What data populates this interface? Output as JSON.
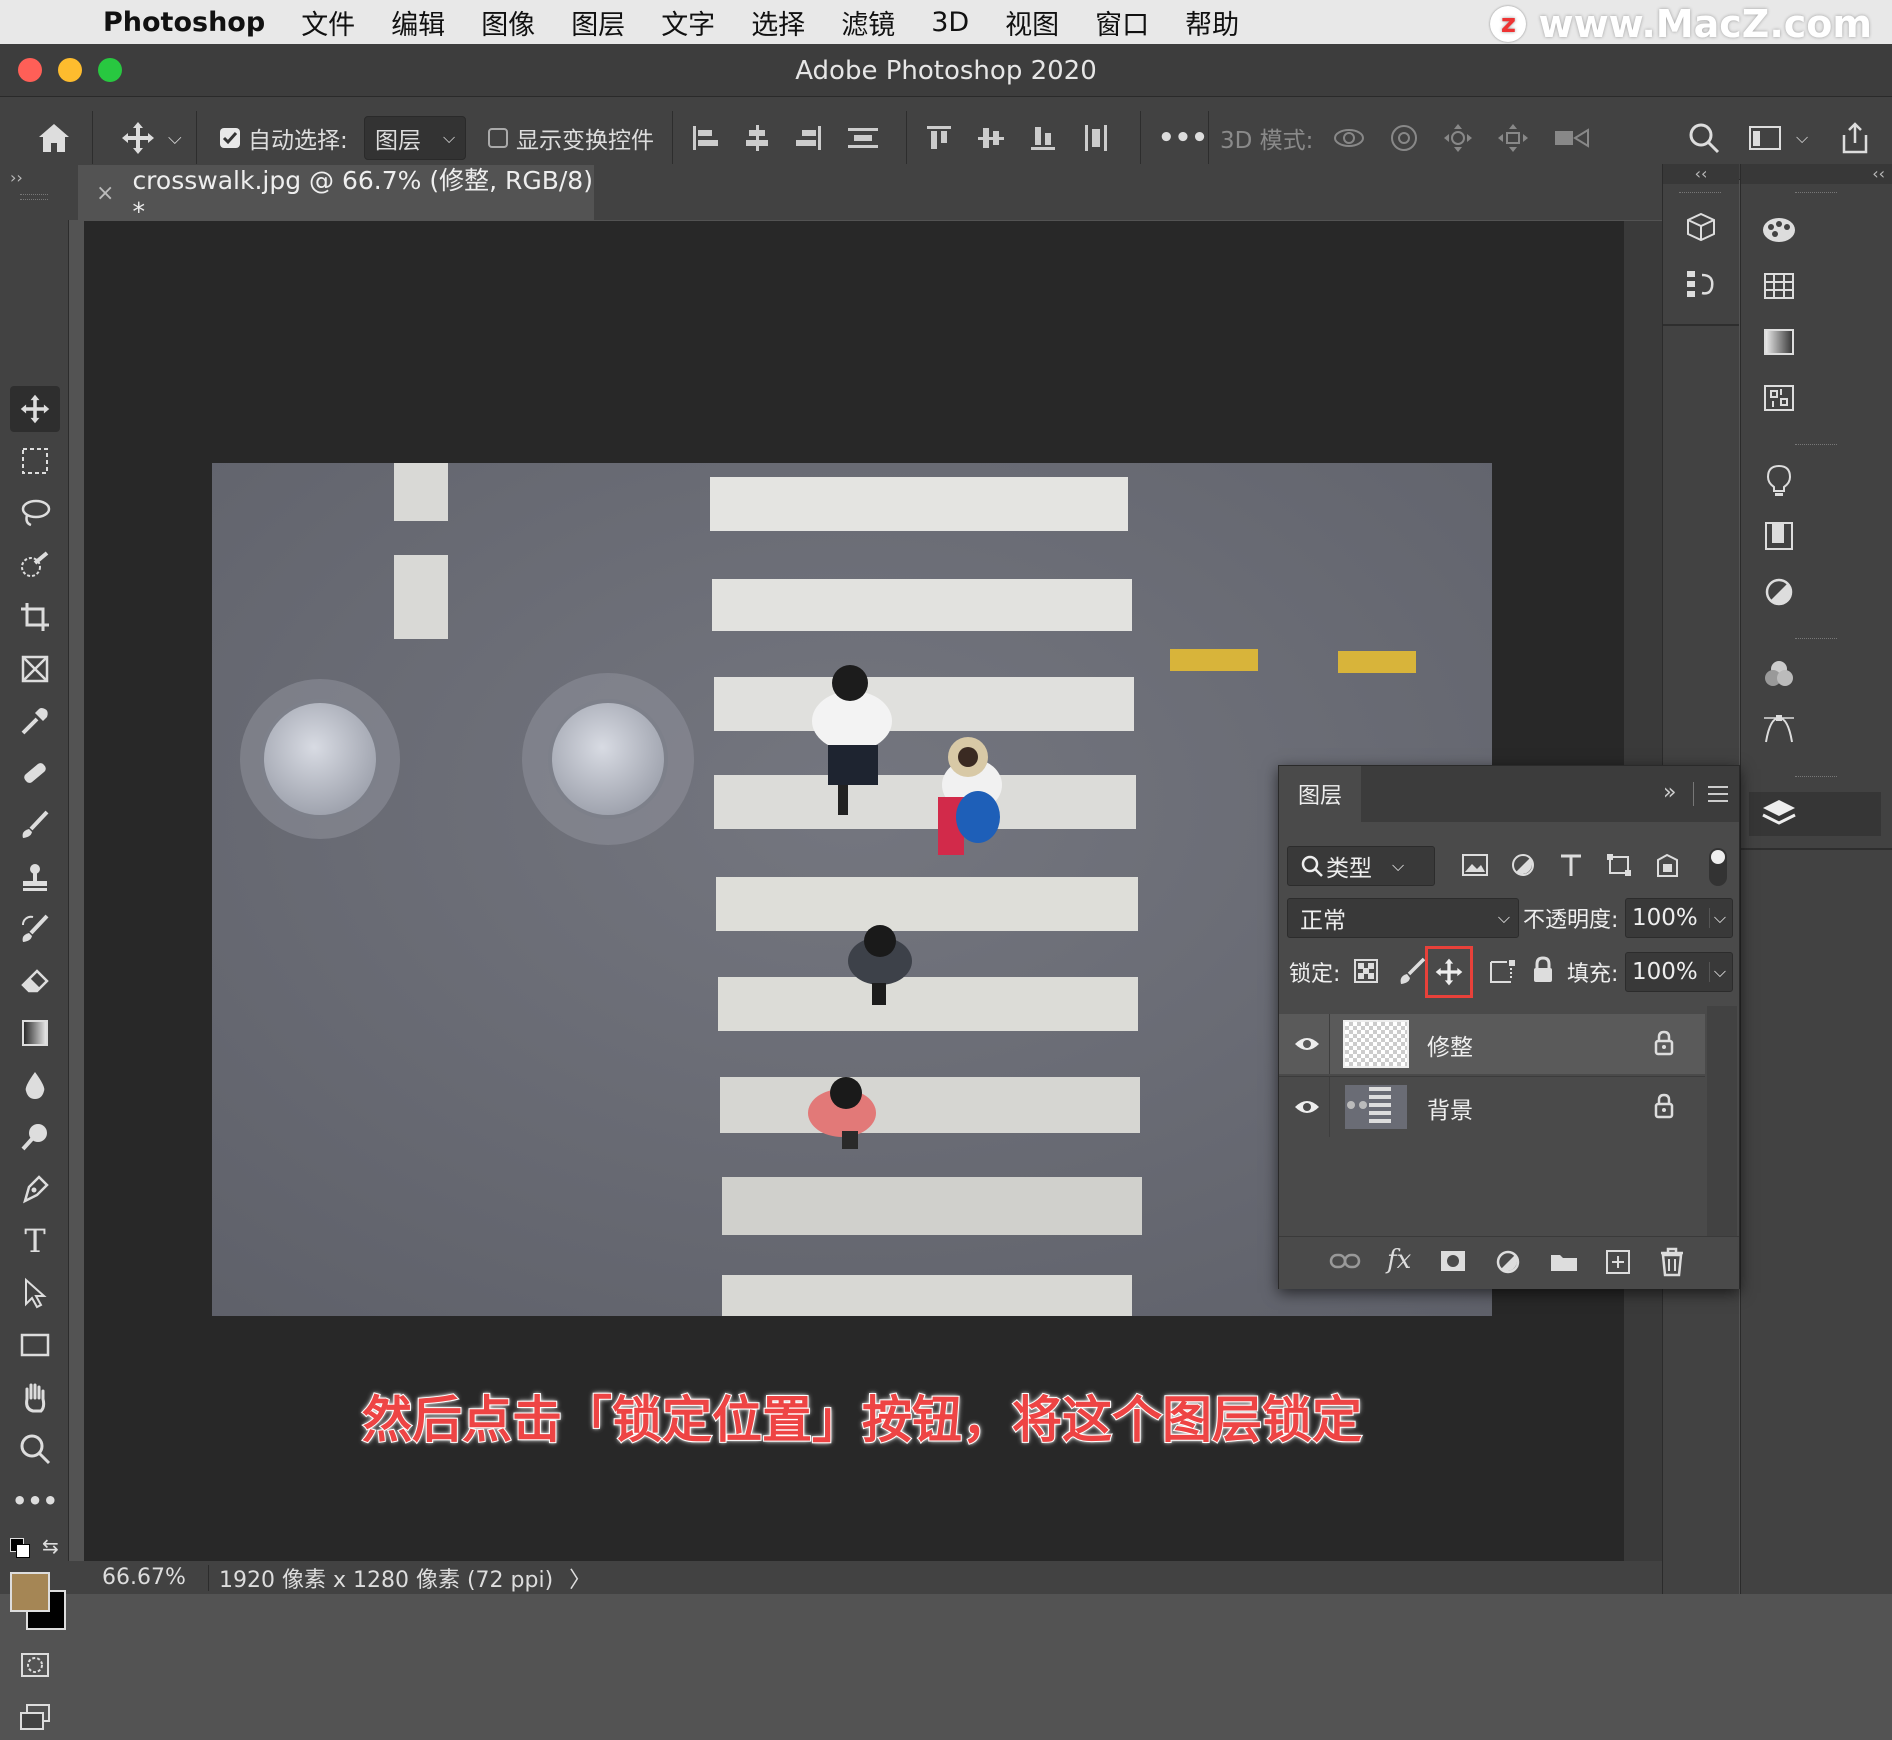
{
  "menubar": {
    "app_name": "Photoshop",
    "items": [
      "文件",
      "编辑",
      "图像",
      "图层",
      "文字",
      "选择",
      "滤镜",
      "3D",
      "视图",
      "窗口",
      "帮助"
    ],
    "watermark": "www.MacZ.com",
    "watermark_badge": "z"
  },
  "window": {
    "title": "Adobe Photoshop 2020",
    "colors": {
      "close": "#ff5f57",
      "minimize": "#febc2e",
      "zoom": "#28c840"
    }
  },
  "options_bar": {
    "auto_select_label": "自动选择:",
    "auto_select_checked": true,
    "auto_select_target": "图层",
    "show_transform_label": "显示变换控件",
    "show_transform_checked": false,
    "more": "•••",
    "mode_3d_label": "3D 模式:"
  },
  "document": {
    "tab_title": "crosswalk.jpg @ 66.7% (修整, RGB/8) *",
    "close_glyph": "×"
  },
  "status_bar": {
    "zoom": "66.67%",
    "info": "1920 像素 x 1280 像素 (72 ppi)",
    "arrow": "〉"
  },
  "layers_panel": {
    "title": "图层",
    "filter_type": "类型",
    "blend_mode": "正常",
    "opacity_label": "不透明度:",
    "opacity_value": "100%",
    "lock_label": "锁定:",
    "fill_label": "填充:",
    "fill_value": "100%",
    "layers": [
      {
        "name": "修整",
        "visible": true,
        "locked": true,
        "selected": true
      },
      {
        "name": "背景",
        "visible": true,
        "locked": true,
        "selected": false
      }
    ],
    "highlight_color": "#e8413a"
  },
  "caption": "然后点击「锁定位置」按钮，将这个图层锁定",
  "colors": {
    "foreground_swatch": "#a58655",
    "background_swatch": "#000000"
  }
}
